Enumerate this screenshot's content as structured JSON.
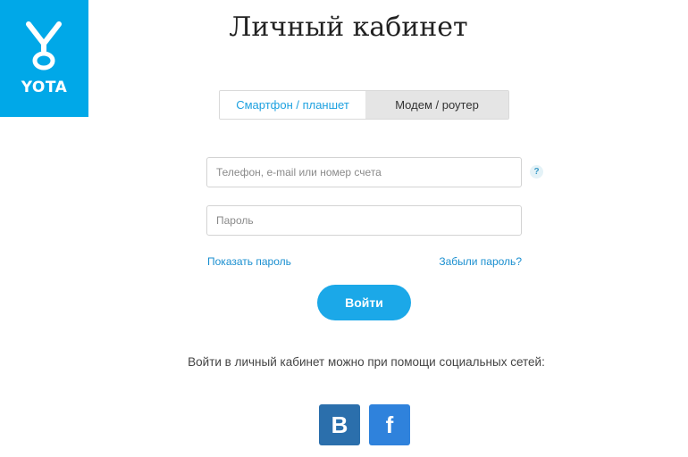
{
  "logo": {
    "text": "YOTA"
  },
  "title": "Личный кабинет",
  "device_tabs": [
    {
      "label": "Смартфон / планшет",
      "active": true
    },
    {
      "label": "Модем / роутер",
      "active": false
    }
  ],
  "login_field": {
    "placeholder": "Телефон, e-mail или номер счета",
    "value": ""
  },
  "help": {
    "icon": "question-icon",
    "label": "?"
  },
  "password_field": {
    "placeholder": "Пароль",
    "value": ""
  },
  "links": {
    "show_password": "Показать пароль",
    "forgot_password": "Забыли пароль?"
  },
  "login_button": "Войти",
  "social": {
    "text": "Войти в личный кабинет можно при помощи социальных сетей:",
    "buttons": [
      {
        "label": "B",
        "icon": "vk-icon",
        "color": "#2b6fac"
      },
      {
        "label": "f",
        "icon": "facebook-icon",
        "color": "#2f82dc"
      }
    ]
  },
  "colors": {
    "brand": "#00a8e8",
    "button": "#1ba8e8",
    "link": "#1a8fd0"
  }
}
